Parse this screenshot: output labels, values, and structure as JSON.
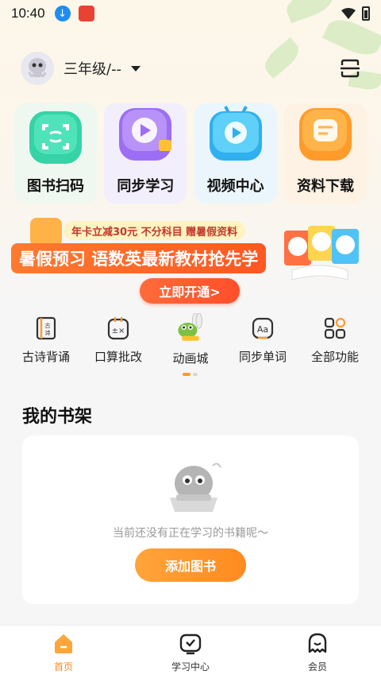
{
  "status": {
    "time": "10:40"
  },
  "header": {
    "grade": "三年级/--"
  },
  "tiles": [
    {
      "label": "图书扫码",
      "icon": "scan-book-icon"
    },
    {
      "label": "同步学习",
      "icon": "play-study-icon"
    },
    {
      "label": "视频中心",
      "icon": "video-tv-icon"
    },
    {
      "label": "资料下载",
      "icon": "document-download-icon"
    }
  ],
  "banner": {
    "subtitle": "年卡立减30元  不分科目  赠暑假资料",
    "title": "暑假预习 语数英最新教材抢先学",
    "cta": "立即开通>"
  },
  "shortcuts": [
    {
      "label": "古诗背诵",
      "icon": "poem-book-icon"
    },
    {
      "label": "口算批改",
      "icon": "calculator-icon"
    },
    {
      "label": "动画城",
      "icon": "cartoon-icon"
    },
    {
      "label": "同步单词",
      "icon": "word-icon"
    },
    {
      "label": "全部功能",
      "icon": "grid-icon"
    }
  ],
  "bookshelf": {
    "title": "我的书架",
    "empty_text": "当前还没有正在学习的书籍呢～",
    "add_button": "添加图书"
  },
  "tabbar": [
    {
      "label": "首页",
      "icon": "home-icon",
      "active": true
    },
    {
      "label": "学习中心",
      "icon": "tv-icon",
      "active": false
    },
    {
      "label": "会员",
      "icon": "ghost-icon",
      "active": false
    }
  ],
  "colors": {
    "accent": "#ff8a1f",
    "banner_red": "#ff5722",
    "tile_green": "#2fd3a5",
    "tile_purple": "#a77cf5",
    "tile_blue": "#38b6f2",
    "tile_orange": "#ffa23a"
  }
}
